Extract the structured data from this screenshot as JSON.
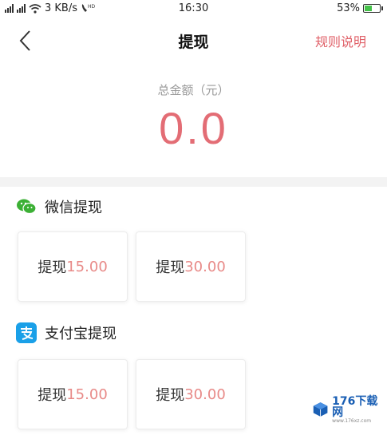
{
  "status_bar": {
    "network_left": "4G",
    "network_right": "2G",
    "speed": "3 KB/s",
    "hd": "HD",
    "time": "16:30",
    "battery": "53%",
    "battery_level": 0.53,
    "battery_color": "#45c24a"
  },
  "header": {
    "back_icon": "chevron-left-icon",
    "title": "提现",
    "rules": "规则说明"
  },
  "balance": {
    "label": "总金额（元）",
    "value": "0.0"
  },
  "wechat": {
    "title": "微信提现",
    "icon": "wechat-icon",
    "options": [
      {
        "label": "提现",
        "amount": "15.00"
      },
      {
        "label": "提现",
        "amount": "30.00"
      }
    ]
  },
  "alipay": {
    "title": "支付宝提现",
    "icon": "alipay-icon",
    "options": [
      {
        "label": "提现",
        "amount": "15.00"
      },
      {
        "label": "提现",
        "amount": "30.00"
      }
    ]
  },
  "watermark": {
    "text": "176下载网",
    "sub": "www.176xz.com"
  },
  "colors": {
    "accent": "#e36d75",
    "amount": "#e88a88",
    "wechat": "#3cb035",
    "alipay": "#1aa0e8"
  }
}
